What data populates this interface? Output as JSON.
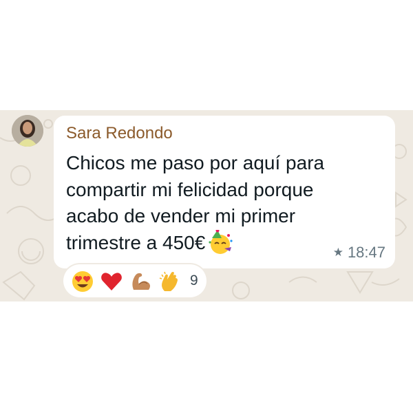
{
  "message": {
    "sender_name": "Sara Redondo",
    "text_lines": [
      "Chicos me paso por aquí para",
      "compartir mi felicidad porque",
      "acabo de vender mi primer",
      "trimestre a 450€"
    ],
    "trailing_emoji": "partying-face",
    "starred": true,
    "time": "18:47"
  },
  "reactions": {
    "emojis": [
      "heart-eyes",
      "red-heart",
      "flexed-biceps",
      "clapping-hands"
    ],
    "count": "9"
  },
  "colors": {
    "chat_background": "#efeae2",
    "bubble": "#ffffff",
    "sender_name": "#8b5a2b",
    "message_text": "#111b21",
    "meta_text": "#667781"
  }
}
